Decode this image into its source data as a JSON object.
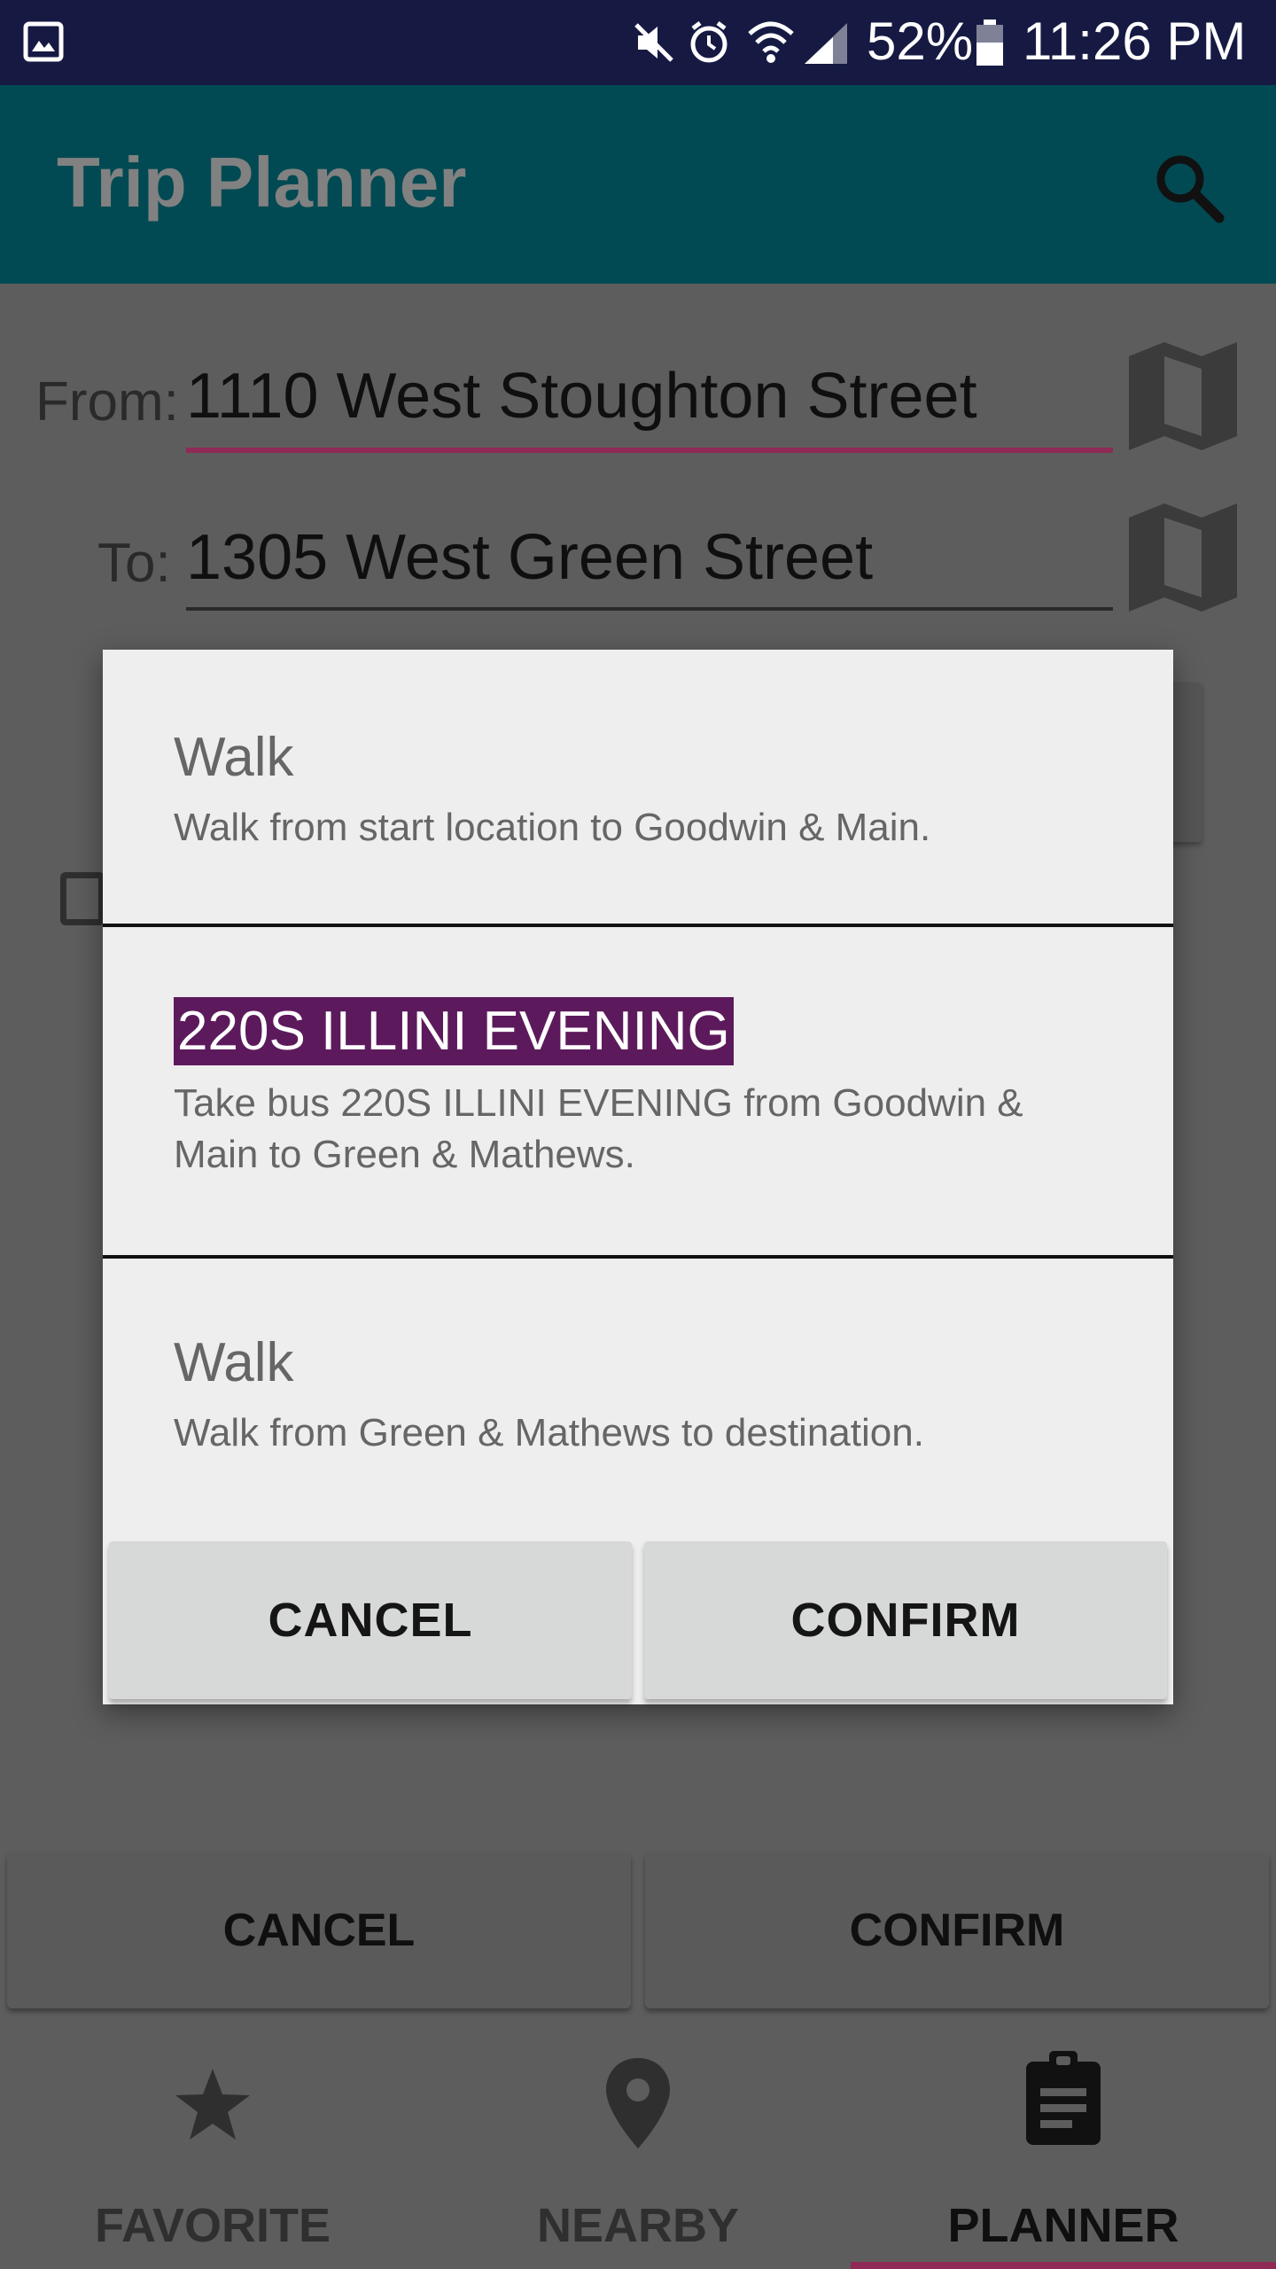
{
  "status_bar": {
    "battery": "52%",
    "time": "11:26 PM"
  },
  "app_bar": {
    "title": "Trip Planner"
  },
  "form": {
    "from_label": "From:",
    "from_value": "1110 West Stoughton Street",
    "to_label": "To:",
    "to_value": "1305 West Green Street"
  },
  "dialog": {
    "steps": [
      {
        "title": "Walk",
        "description": "Walk from start location to Goodwin & Main."
      },
      {
        "title": "220S ILLINI EVENING",
        "description": "Take bus 220S ILLINI EVENING from Goodwin & Main to Green & Mathews."
      },
      {
        "title": "Walk",
        "description": "Walk from Green & Mathews to destination."
      }
    ],
    "cancel_label": "CANCEL",
    "confirm_label": "CONFIRM"
  },
  "actions": {
    "cancel_label": "CANCEL",
    "confirm_label": "CONFIRM"
  },
  "bottom_nav": {
    "items": [
      {
        "label": "FAVORITE",
        "icon": "star-icon"
      },
      {
        "label": "NEARBY",
        "icon": "location-pin-icon"
      },
      {
        "label": "PLANNER",
        "icon": "clipboard-icon"
      }
    ],
    "active_index": 2
  },
  "colors": {
    "status_bar": "#161a43",
    "app_bar": "#024a53",
    "accent": "#8e2a55",
    "route_badge": "#5c1a5c"
  }
}
